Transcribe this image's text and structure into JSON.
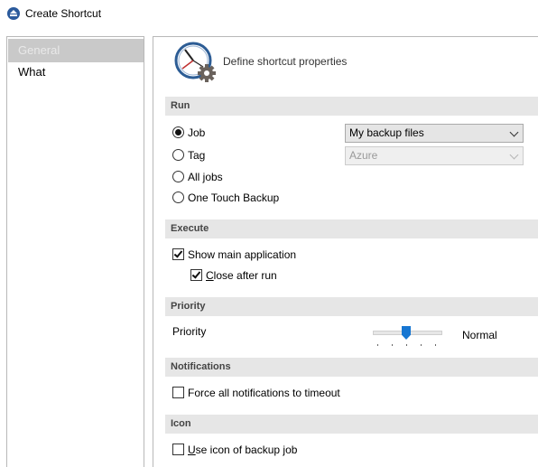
{
  "window": {
    "title": "Create Shortcut"
  },
  "nav": {
    "items": [
      {
        "label": "General",
        "selected": true
      },
      {
        "label": "What",
        "selected": false
      }
    ]
  },
  "header": {
    "title": "Define shortcut properties",
    "icon": "clock-gear-icon"
  },
  "run": {
    "section_label": "Run",
    "options": [
      {
        "label": "Job",
        "checked": true
      },
      {
        "label": "Tag",
        "checked": false
      },
      {
        "label": "All jobs",
        "checked": false
      },
      {
        "label": "One Touch Backup",
        "checked": false
      }
    ],
    "job_select": "My backup files",
    "tag_select": "Azure"
  },
  "execute": {
    "section_label": "Execute",
    "show_main": {
      "label": "Show main application",
      "checked": true
    },
    "close_after_pre": "",
    "close_after_u": "C",
    "close_after_rest": "lose after run",
    "close_after_checked": true
  },
  "priority": {
    "section_label": "Priority",
    "label": "Priority",
    "value_text": "Normal",
    "level_fraction": 0.5
  },
  "notifications": {
    "section_label": "Notifications",
    "force_timeout": {
      "label": "Force all notifications to timeout",
      "checked": false
    }
  },
  "icon": {
    "section_label": "Icon",
    "use_icon_u": "U",
    "use_icon_rest": "se icon of backup job",
    "checked": false
  },
  "colors": {
    "accent": "#1676d2",
    "section_bg": "#e6e6e6",
    "selected_nav": "#c9c9c9"
  }
}
